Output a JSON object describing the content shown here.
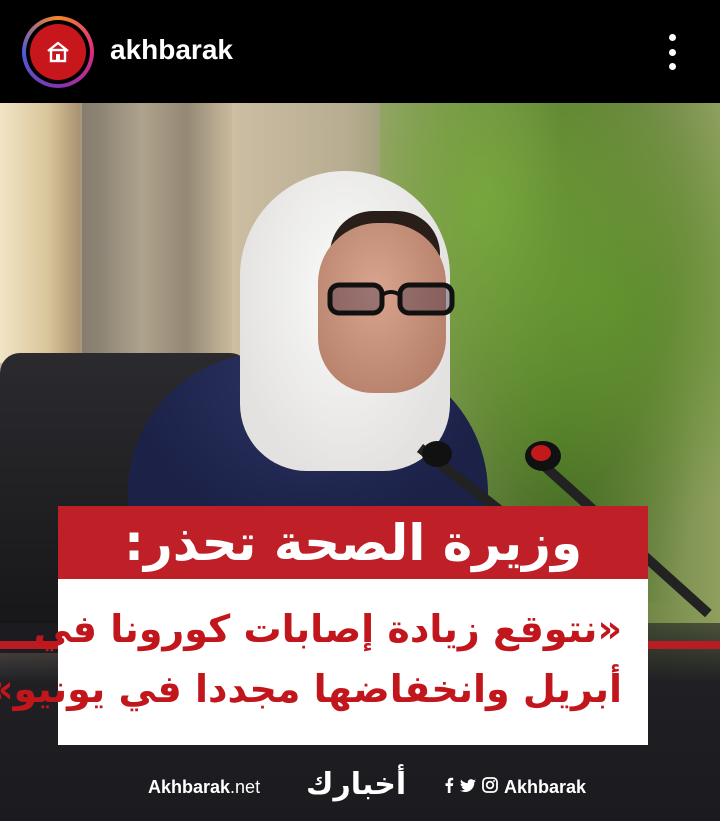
{
  "header": {
    "username": "akhbarak",
    "avatar_icon": "house-icon",
    "more_icon": "more-vertical-icon",
    "avatar_color": "#c8161d"
  },
  "post": {
    "headline": "وزيرة الصحة تحذر:",
    "quote_lines": [
      "«نتوقع زيادة إصابات كورونا في",
      "أبريل وانخفاضها مجددا في يونيو»"
    ],
    "accent_color": "#bf1f26",
    "footer": {
      "site_bold": "Akhbarak",
      "site_light": ".net",
      "logo": "أخبارك",
      "social_handle": "Akhbarak",
      "social_icons": [
        "facebook-icon",
        "twitter-icon",
        "instagram-icon"
      ]
    }
  }
}
